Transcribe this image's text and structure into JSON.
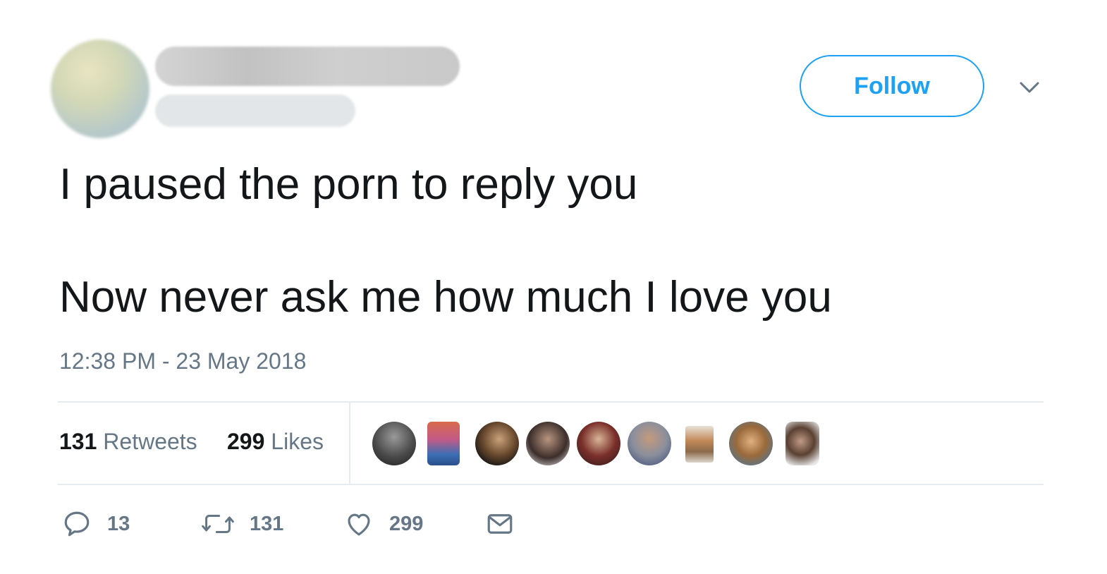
{
  "tweet": {
    "follow_label": "Follow",
    "text_line1": "I paused the porn to reply you",
    "text_line2": "Now never ask me how much I love you",
    "timestamp": "12:38 PM - 23 May 2018",
    "stats": {
      "retweets_count": "131",
      "retweets_label": "Retweets",
      "likes_count": "299",
      "likes_label": "Likes"
    },
    "actions": {
      "reply_count": "13",
      "retweet_count": "131",
      "like_count": "299"
    },
    "colors": {
      "accent": "#1da1f2",
      "text": "#14171a",
      "secondary": "#657786",
      "divider": "#e6ecf0"
    },
    "icons": [
      "chevron-down-icon",
      "reply-icon",
      "retweet-icon",
      "heart-icon",
      "envelope-icon"
    ],
    "liker_avatar_count": 9
  }
}
